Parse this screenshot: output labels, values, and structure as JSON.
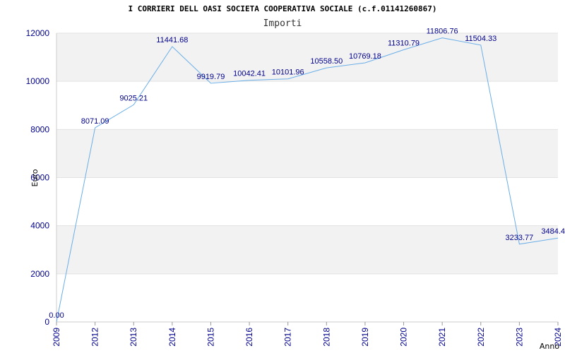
{
  "chart_data": {
    "type": "line",
    "title": "I CORRIERI DELL OASI SOCIETA COOPERATIVA SOCIALE (c.f.01141260867)",
    "subtitle": "Importi",
    "xlabel": "Anno",
    "ylabel": "Euro",
    "categories": [
      "2009",
      "2012",
      "2013",
      "2014",
      "2015",
      "2016",
      "2017",
      "2018",
      "2019",
      "2020",
      "2021",
      "2022",
      "2023",
      "2024"
    ],
    "values": [
      0.0,
      8071.09,
      9025.21,
      11441.68,
      9919.79,
      10042.41,
      10101.96,
      10558.5,
      10769.18,
      11310.79,
      11806.76,
      11504.33,
      3233.77,
      3484.4
    ],
    "data_labels": [
      "0.00",
      "8071.09",
      "9025.21",
      "11441.68",
      "9919.79",
      "10042.41",
      "10101.96",
      "10558.50",
      "10769.18",
      "11310.79",
      "11806.76",
      "11504.33",
      "3233.77",
      "3484.4"
    ],
    "yticks": [
      0,
      2000,
      4000,
      6000,
      8000,
      10000,
      12000
    ],
    "ylim": [
      0,
      12000
    ],
    "grid": true,
    "line_color": "#6aaee8",
    "band_color": "#f2f2f2",
    "tick_color": "#00008b",
    "label_color": "#00008b"
  }
}
